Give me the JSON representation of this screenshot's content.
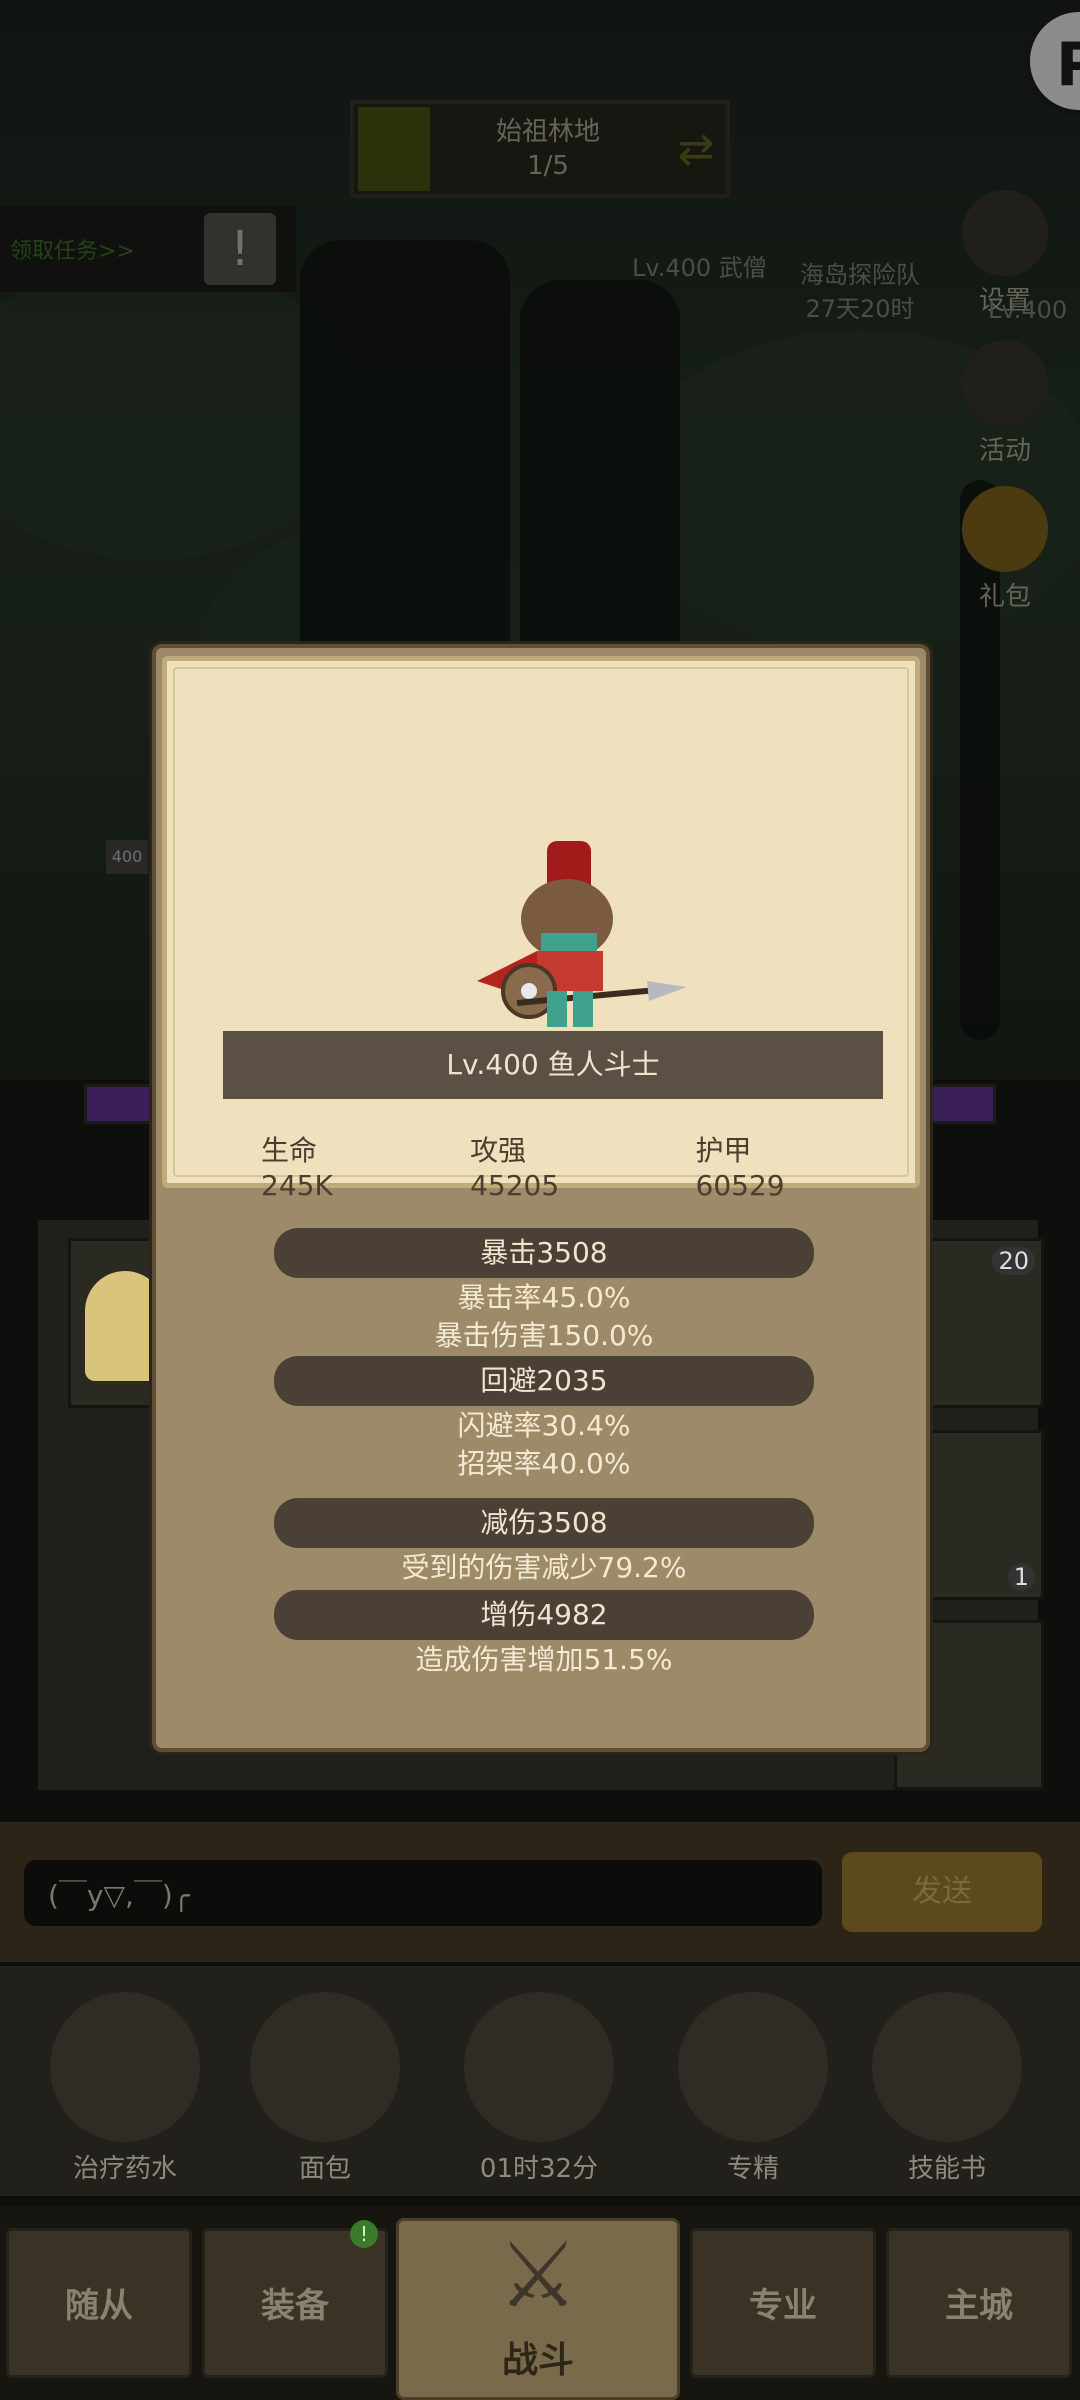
{
  "hud": {
    "stage_name": "始祖林地",
    "stage_progress": "1/5",
    "quest_label": "领取任务>>",
    "quest_alert": "!",
    "top_badge_letter": "P",
    "npc_monk": "Lv.400 武僧",
    "event_title": "海岛探险队",
    "event_timer": "27天20时",
    "settings_label": "设置",
    "settings_level": "Lv.400",
    "activity_label": "活动",
    "gift_label": "礼包",
    "level_tag": "400"
  },
  "popup": {
    "monster_name": "Lv.400 鱼人斗士",
    "stats": {
      "hp": "生命245K",
      "attack": "攻强45205",
      "armor": "护甲60529"
    },
    "crit": {
      "title": "暴击3508",
      "rate": "暴击率45.0%",
      "damage": "暴击伤害150.0%"
    },
    "dodge": {
      "title": "回避2035",
      "evade": "闪避率30.4%",
      "parry": "招架率40.0%"
    },
    "reduction": {
      "title": "减伤3508",
      "desc": "受到的伤害减少79.2%"
    },
    "boost": {
      "title": "增伤4982",
      "desc": "造成伤害增加51.5%"
    }
  },
  "skills": {
    "slot_count_1": "20",
    "slot_count_2": "1"
  },
  "chat": {
    "input_value": "(￣y▽,￣)╭",
    "send_label": "发送"
  },
  "consumables": {
    "potion": "治疗药水",
    "bread": "面包",
    "chest_timer": "01时32分",
    "mastery": "专精",
    "skill_book": "技能书"
  },
  "nav": {
    "followers": "随从",
    "equipment": "装备",
    "equipment_badge": "!",
    "battle": "战斗",
    "profession": "专业",
    "main_city": "主城"
  }
}
